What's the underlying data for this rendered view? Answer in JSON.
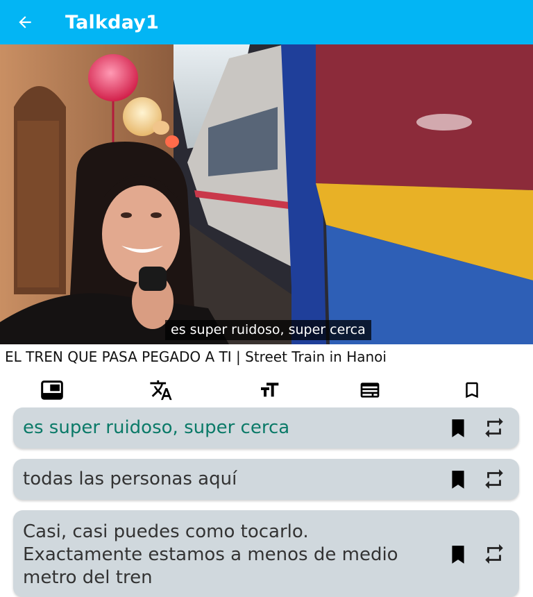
{
  "app": {
    "title": "Talkday1",
    "back_icon": "arrow-left-icon"
  },
  "video": {
    "caption": "es super ruidoso, super cerca",
    "title": "EL TREN QUE PASA PEGADO A TI | Street Train in Hanoi"
  },
  "toolbar": {
    "items": [
      {
        "icon": "picture-in-picture-icon"
      },
      {
        "icon": "translate-icon"
      },
      {
        "icon": "text-size-icon"
      },
      {
        "icon": "subtitles-icon"
      },
      {
        "icon": "bookmark-outline-icon"
      }
    ]
  },
  "sentences": [
    {
      "line1": "es super ruidoso, super cerca",
      "active": true
    },
    {
      "line1": "todas las personas aquí",
      "active": false
    },
    {
      "line1": "Casi, casi puedes como tocarlo.",
      "line2": "Exactamente estamos a menos de medio",
      "line3": "metro del tren",
      "active": false
    }
  ],
  "colors": {
    "appbar": "#03b5f4",
    "card": "#d0d8dd",
    "active_text": "#0b7a68"
  }
}
